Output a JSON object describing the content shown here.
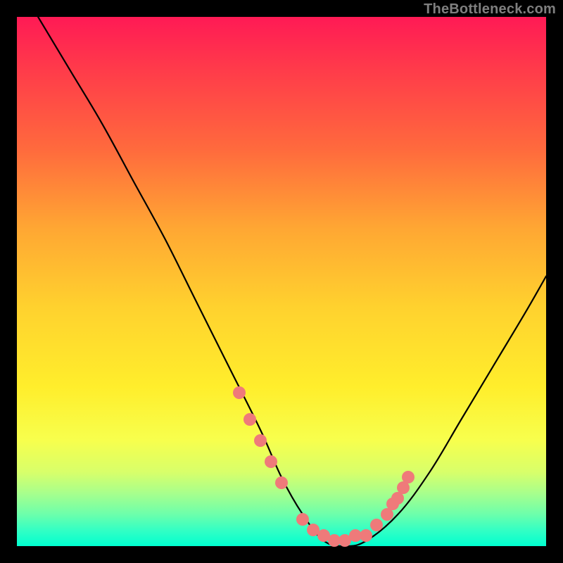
{
  "watermark": "TheBottleneck.com",
  "chart_data": {
    "type": "line",
    "title": "",
    "xlabel": "",
    "ylabel": "",
    "xlim": [
      0,
      100
    ],
    "ylim": [
      0,
      100
    ],
    "grid": false,
    "legend": false,
    "series": [
      {
        "name": "bottleneck-curve",
        "color": "#000000",
        "x": [
          4,
          10,
          16,
          22,
          28,
          34,
          40,
          46,
          50,
          54,
          58,
          62,
          66,
          72,
          78,
          84,
          90,
          96,
          100
        ],
        "y": [
          100,
          90,
          80,
          69,
          58,
          46,
          34,
          22,
          13,
          6,
          1,
          0,
          1,
          6,
          14,
          24,
          34,
          44,
          51
        ]
      }
    ],
    "markers": {
      "name": "highlight-dots",
      "color": "#ef7a7a",
      "x": [
        42,
        44,
        46,
        48,
        50,
        54,
        56,
        58,
        60,
        62,
        64,
        66,
        68,
        70,
        71,
        72,
        73,
        74
      ],
      "y": [
        29,
        24,
        20,
        16,
        12,
        5,
        3,
        2,
        1,
        1,
        2,
        2,
        4,
        6,
        8,
        9,
        11,
        13
      ]
    },
    "background_gradient": {
      "top": "#ff1a55",
      "mid": "#ffd22e",
      "bottom": "#00ffd0"
    }
  }
}
